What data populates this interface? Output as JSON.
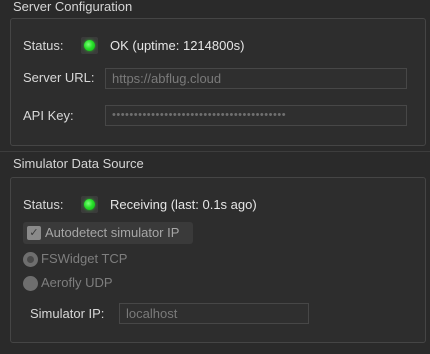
{
  "server": {
    "section_title": "Server Configuration",
    "status_label": "Status:",
    "status_text": "OK (uptime: 1214800s)",
    "url_label": "Server URL:",
    "url_value": "https://abflug.cloud",
    "api_label": "API Key:",
    "api_value": "••••••••••••••••••••••••••••••••••••••••"
  },
  "simulator": {
    "section_title": "Simulator Data Source",
    "status_label": "Status:",
    "status_text": "Receiving (last: 0.1s ago)",
    "autodetect_label": "Autodetect simulator IP",
    "autodetect_checked": true,
    "radio_fswidget": "FSWidget TCP",
    "radio_aerofly": "Aerofly UDP",
    "ip_label": "Simulator IP:",
    "ip_value": "localhost"
  },
  "colors": {
    "status_ok": "#28e02a",
    "background": "#2a2a2a"
  }
}
